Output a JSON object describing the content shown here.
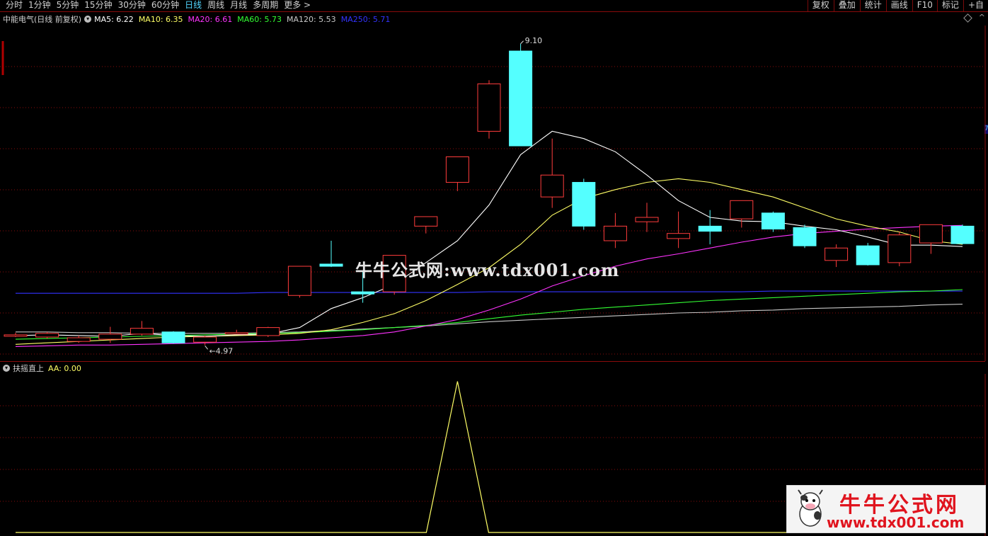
{
  "toolbar": {
    "periods": [
      "分时",
      "1分钟",
      "5分钟",
      "15分钟",
      "30分钟",
      "60分钟",
      "日线",
      "周线",
      "月线",
      "多周期",
      "更多 >"
    ],
    "active_period": "日线",
    "right_tools": [
      "复权",
      "叠加",
      "统计",
      "画线",
      "F10",
      "标记",
      "+自"
    ]
  },
  "main_panel": {
    "title": "中能电气(日线 前复权)",
    "indicators": [
      {
        "label": "MA5: 6.22",
        "color": "#ffffff"
      },
      {
        "label": "MA10: 6.35",
        "color": "#ffff66"
      },
      {
        "label": "MA20: 6.61",
        "color": "#ff33ff"
      },
      {
        "label": "MA60: 5.73",
        "color": "#33ff33"
      },
      {
        "label": "MA120: 5.53",
        "color": "#c8c8c8"
      },
      {
        "label": "MA250: 5.71",
        "color": "#3333ff"
      }
    ],
    "high_label": "9.10",
    "low_label": "4.97",
    "edge_tag": "7"
  },
  "sub_panel": {
    "title": "扶摇直上",
    "value": "AA: 0.00"
  },
  "watermark": "牛牛公式网:www.tdx001.com",
  "logo": {
    "title": "牛牛公式网",
    "url": "www.tdx001.com"
  },
  "colors": {
    "up": "#ff3c3c",
    "down": "#54ffff",
    "grid": "#8a0b0b",
    "ma5": "#ffffff",
    "ma10": "#ffff66",
    "ma20": "#ff33ff",
    "ma60": "#33ff33",
    "ma120": "#c8c8c8",
    "ma250": "#3333ff"
  },
  "chart_data": {
    "type": "candlestick",
    "candles": [
      {
        "o": 5.1,
        "h": 5.14,
        "l": 5.08,
        "c": 5.11
      },
      {
        "o": 5.08,
        "h": 5.15,
        "l": 5.06,
        "c": 5.13
      },
      {
        "o": 5.02,
        "h": 5.1,
        "l": 5.0,
        "c": 5.07
      },
      {
        "o": 5.05,
        "h": 5.22,
        "l": 5.0,
        "c": 5.12
      },
      {
        "o": 5.12,
        "h": 5.3,
        "l": 5.1,
        "c": 5.2
      },
      {
        "o": 5.15,
        "h": 5.16,
        "l": 4.99,
        "c": 5.0
      },
      {
        "o": 5.01,
        "h": 5.1,
        "l": 4.97,
        "c": 5.08
      },
      {
        "o": 5.13,
        "h": 5.18,
        "l": 5.12,
        "c": 5.14
      },
      {
        "o": 5.1,
        "h": 5.22,
        "l": 5.08,
        "c": 5.21
      },
      {
        "o": 5.65,
        "h": 6.05,
        "l": 5.62,
        "c": 6.05
      },
      {
        "o": 6.08,
        "h": 6.4,
        "l": 6.04,
        "c": 6.05
      },
      {
        "o": 5.7,
        "h": 5.98,
        "l": 5.55,
        "c": 5.67
      },
      {
        "o": 5.7,
        "h": 6.2,
        "l": 5.66,
        "c": 6.2
      },
      {
        "o": 6.6,
        "h": 6.71,
        "l": 6.5,
        "c": 6.73
      },
      {
        "o": 7.2,
        "h": 7.55,
        "l": 7.08,
        "c": 7.55
      },
      {
        "o": 7.9,
        "h": 8.6,
        "l": 7.8,
        "c": 8.55
      },
      {
        "o": 9.0,
        "h": 9.1,
        "l": 7.7,
        "c": 7.7
      },
      {
        "o": 7.0,
        "h": 7.8,
        "l": 6.85,
        "c": 7.3
      },
      {
        "o": 7.2,
        "h": 7.25,
        "l": 6.55,
        "c": 6.6
      },
      {
        "o": 6.4,
        "h": 6.78,
        "l": 6.3,
        "c": 6.6
      },
      {
        "o": 6.66,
        "h": 6.92,
        "l": 6.52,
        "c": 6.72
      },
      {
        "o": 6.43,
        "h": 6.8,
        "l": 6.3,
        "c": 6.5
      },
      {
        "o": 6.6,
        "h": 6.82,
        "l": 6.35,
        "c": 6.53
      },
      {
        "o": 6.7,
        "h": 6.92,
        "l": 6.58,
        "c": 6.95
      },
      {
        "o": 6.78,
        "h": 6.8,
        "l": 6.52,
        "c": 6.56
      },
      {
        "o": 6.58,
        "h": 6.62,
        "l": 6.3,
        "c": 6.33
      },
      {
        "o": 6.13,
        "h": 6.35,
        "l": 6.04,
        "c": 6.3
      },
      {
        "o": 6.33,
        "h": 6.37,
        "l": 6.06,
        "c": 6.07
      },
      {
        "o": 6.1,
        "h": 6.52,
        "l": 6.05,
        "c": 6.48
      },
      {
        "o": 6.37,
        "h": 6.62,
        "l": 6.22,
        "c": 6.62
      },
      {
        "o": 6.6,
        "h": 6.62,
        "l": 6.35,
        "c": 6.36
      }
    ],
    "ma5": [
      5.1,
      5.11,
      5.1,
      5.09,
      5.13,
      5.1,
      5.09,
      5.11,
      5.12,
      5.21,
      5.47,
      5.62,
      5.8,
      6.1,
      6.4,
      6.89,
      7.58,
      7.9,
      7.8,
      7.62,
      7.3,
      6.95,
      6.72,
      6.67,
      6.66,
      6.6,
      6.55,
      6.45,
      6.34,
      6.34,
      6.32
    ],
    "ma10": [
      4.98,
      5.0,
      5.02,
      5.04,
      5.06,
      5.08,
      5.09,
      5.1,
      5.11,
      5.13,
      5.18,
      5.28,
      5.4,
      5.58,
      5.8,
      6.03,
      6.35,
      6.75,
      6.98,
      7.1,
      7.2,
      7.25,
      7.2,
      7.1,
      7.0,
      6.85,
      6.7,
      6.6,
      6.52,
      6.4,
      6.35
    ],
    "ma20": [
      4.95,
      4.96,
      4.97,
      4.97,
      4.98,
      4.99,
      5.0,
      5.01,
      5.02,
      5.04,
      5.07,
      5.1,
      5.15,
      5.23,
      5.32,
      5.45,
      5.6,
      5.78,
      5.92,
      6.05,
      6.15,
      6.22,
      6.3,
      6.38,
      6.45,
      6.5,
      6.53,
      6.56,
      6.58,
      6.6,
      6.61
    ],
    "ma60": [
      5.05,
      5.06,
      5.07,
      5.08,
      5.09,
      5.1,
      5.11,
      5.12,
      5.13,
      5.14,
      5.16,
      5.18,
      5.21,
      5.24,
      5.28,
      5.33,
      5.38,
      5.42,
      5.46,
      5.49,
      5.52,
      5.55,
      5.58,
      5.6,
      5.62,
      5.64,
      5.66,
      5.68,
      5.7,
      5.71,
      5.73
    ],
    "ma120": [
      5.15,
      5.15,
      5.14,
      5.14,
      5.13,
      5.13,
      5.13,
      5.13,
      5.14,
      5.15,
      5.17,
      5.19,
      5.21,
      5.23,
      5.26,
      5.29,
      5.31,
      5.33,
      5.35,
      5.37,
      5.39,
      5.41,
      5.42,
      5.44,
      5.45,
      5.47,
      5.48,
      5.49,
      5.5,
      5.52,
      5.53
    ],
    "ma250": [
      5.68,
      5.68,
      5.68,
      5.68,
      5.68,
      5.68,
      5.68,
      5.68,
      5.69,
      5.69,
      5.69,
      5.69,
      5.69,
      5.69,
      5.69,
      5.7,
      5.7,
      5.7,
      5.7,
      5.7,
      5.7,
      5.7,
      5.7,
      5.7,
      5.71,
      5.71,
      5.71,
      5.71,
      5.71,
      5.71,
      5.71
    ],
    "ylim": [
      4.75,
      9.35
    ],
    "sub_indicator": {
      "name": "扶摇直上",
      "series_AA": [
        0,
        0,
        0,
        0,
        0,
        0,
        0,
        0,
        0,
        0,
        0,
        0,
        0,
        0,
        1,
        0,
        0,
        0,
        0,
        0,
        0,
        0,
        0,
        0,
        0,
        0,
        0,
        0,
        0,
        0,
        0
      ],
      "ylim": [
        0,
        1.05
      ]
    }
  }
}
